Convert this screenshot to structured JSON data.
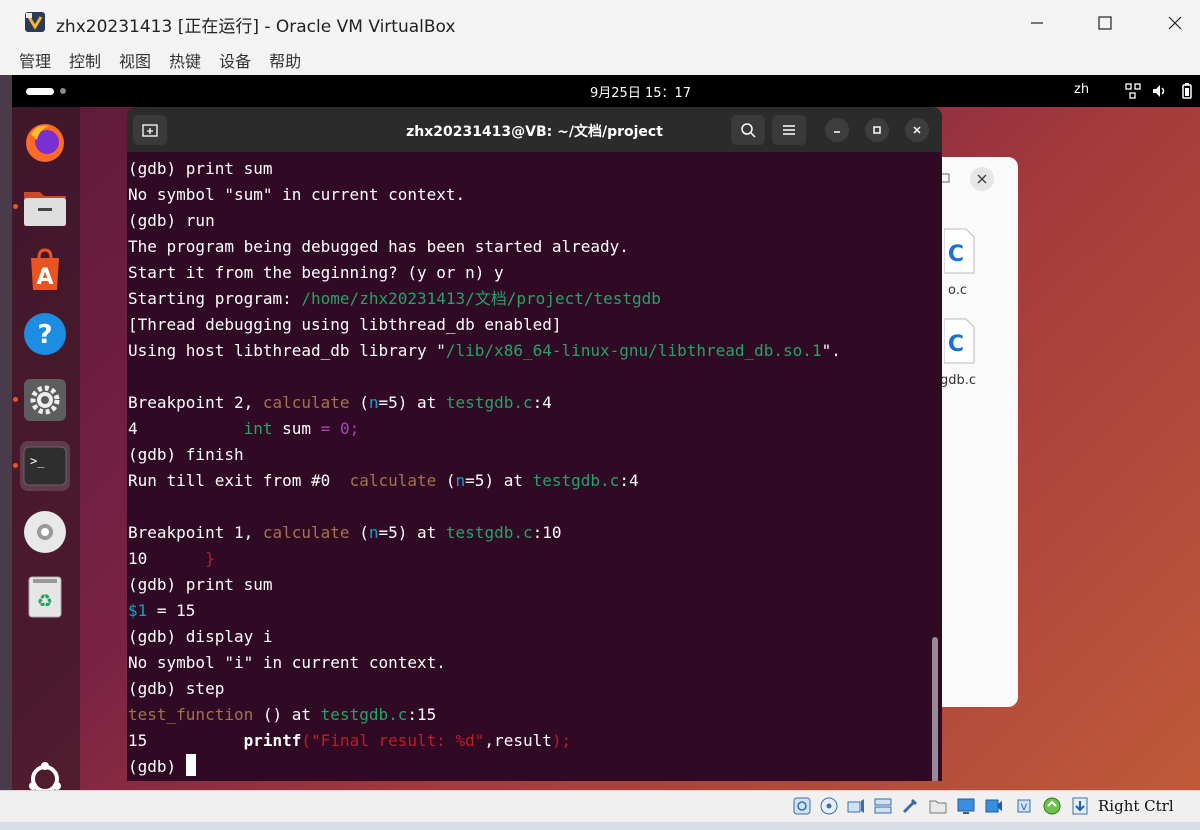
{
  "window": {
    "title": "zhx20231413 [正在运行] - Oracle VM VirtualBox",
    "app_icon": "virtualbox-icon"
  },
  "menubar": [
    "管理",
    "控制",
    "视图",
    "热键",
    "设备",
    "帮助"
  ],
  "guest_topbar": {
    "clock": "9月25日  15：17",
    "input_lang": "zh",
    "tray_icons": [
      "network-icon",
      "volume-icon",
      "battery-icon"
    ]
  },
  "dock": {
    "apps": [
      "firefox-icon",
      "files-icon",
      "app-center-icon",
      "help-icon",
      "settings-icon",
      "terminal-icon",
      "disc-icon",
      "trash-icon"
    ],
    "show_apps_icon": "show-apps-icon"
  },
  "files_window": {
    "items": [
      "o.c",
      "gdb.c"
    ]
  },
  "terminal": {
    "title": "zhx20231413@VB: ~/文档/project",
    "lines": {
      "l1": "(gdb) print sum",
      "l2": "No symbol \"sum\" in current context.",
      "l3": "(gdb) run",
      "l4": "The program being debugged has been started already.",
      "l5": "Start it from the beginning? (y or n) y",
      "l6a": "Starting program: ",
      "l6b": "/home/zhx20231413/文档/project/testgdb",
      "l7": "[Thread debugging using libthread_db enabled]",
      "l8a": "Using host libthread_db library \"",
      "l8b": "/lib/x86_64-linux-gnu/libthread_db.so.1",
      "l8c": "\".",
      "l10a": "Breakpoint 2, ",
      "l10b": "calculate",
      "l10c": " (",
      "l10d": "n",
      "l10e": "=5) at ",
      "l10f": "testgdb.c",
      "l10g": ":4",
      "l11a": "4           ",
      "l11b": "int",
      "l11c": " sum ",
      "l11d": "=",
      "l11e": " 0;",
      "l12": "(gdb) finish",
      "l13a": "Run till exit from #0  ",
      "l13b": "calculate",
      "l13c": " (",
      "l13d": "n",
      "l13e": "=5) at ",
      "l13f": "testgdb.c",
      "l13g": ":4",
      "l15a": "Breakpoint 1, ",
      "l15b": "calculate",
      "l15c": " (",
      "l15d": "n",
      "l15e": "=5) at ",
      "l15f": "testgdb.c",
      "l15g": ":10",
      "l16a": "10      ",
      "l16b": "}",
      "l17": "(gdb) print sum",
      "l18a": "$1",
      "l18b": " = 15",
      "l19": "(gdb) display i",
      "l20": "No symbol \"i\" in current context.",
      "l21": "(gdb) step",
      "l22a": "test_function",
      "l22b": " () at ",
      "l22c": "testgdb.c",
      "l22d": ":15",
      "l23a": "15          ",
      "l23b": "printf",
      "l23c": "(",
      "l23d": "\"Final result: %d\"",
      "l23e": ",result",
      "l23f": ");",
      "prompt": "(gdb) "
    }
  },
  "statusbar": {
    "host_key": "Right Ctrl"
  },
  "colors": {
    "terminal_bg": "#300a24",
    "path_green": "#26a269",
    "func_orange": "#a2734c",
    "param_blue": "#12a0c8",
    "string_red": "#c01c28"
  }
}
